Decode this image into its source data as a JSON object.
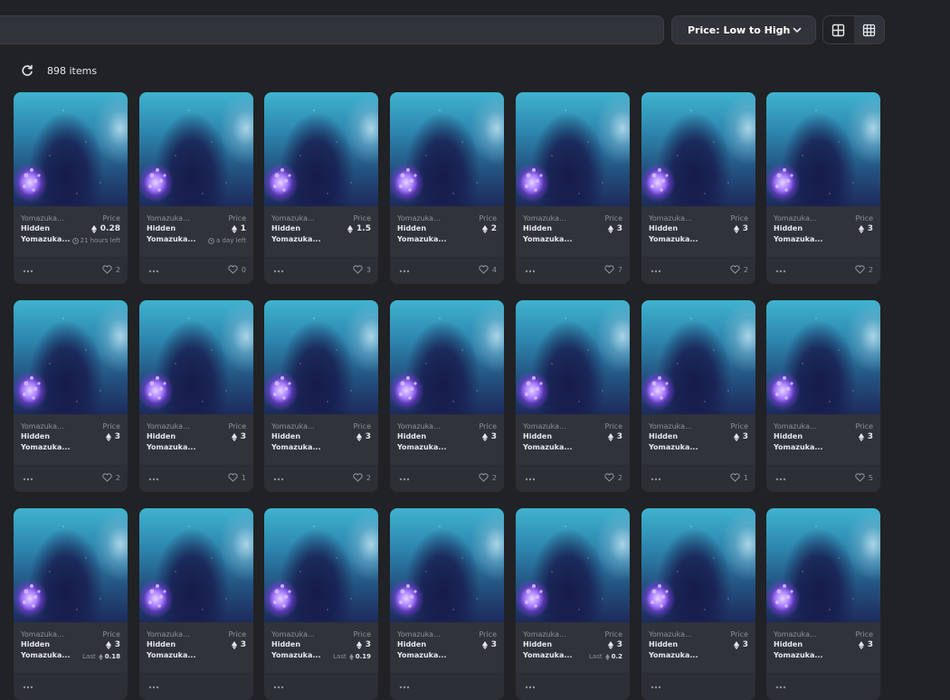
{
  "toolbar": {
    "sort_label": "Price: Low to High",
    "view_options": [
      "large-grid",
      "small-grid"
    ],
    "active_view": "small-grid"
  },
  "results": {
    "count_text": "898 items"
  },
  "card_defaults": {
    "collection": "Yomazuka...",
    "name_line1": "Hidden",
    "name_line2": "Yomazuka...",
    "price_label": "Price"
  },
  "cards": [
    {
      "price": "0.28",
      "sub": "21 hours left",
      "sub_type": "time",
      "likes": "2"
    },
    {
      "price": "1",
      "sub": "a day left",
      "sub_type": "time",
      "likes": "0"
    },
    {
      "price": "1.5",
      "sub": "",
      "sub_type": "",
      "likes": "3"
    },
    {
      "price": "2",
      "sub": "",
      "sub_type": "",
      "likes": "4"
    },
    {
      "price": "3",
      "sub": "",
      "sub_type": "",
      "likes": "7"
    },
    {
      "price": "3",
      "sub": "",
      "sub_type": "",
      "likes": "2"
    },
    {
      "price": "3",
      "sub": "",
      "sub_type": "",
      "likes": "2"
    },
    {
      "price": "3",
      "sub": "",
      "sub_type": "",
      "likes": "2"
    },
    {
      "price": "3",
      "sub": "",
      "sub_type": "",
      "likes": "1"
    },
    {
      "price": "3",
      "sub": "",
      "sub_type": "",
      "likes": "2"
    },
    {
      "price": "3",
      "sub": "",
      "sub_type": "",
      "likes": "2"
    },
    {
      "price": "3",
      "sub": "",
      "sub_type": "",
      "likes": "2"
    },
    {
      "price": "3",
      "sub": "",
      "sub_type": "",
      "likes": "1"
    },
    {
      "price": "3",
      "sub": "",
      "sub_type": "",
      "likes": "5"
    },
    {
      "price": "3",
      "sub": "0.18",
      "sub_type": "last",
      "likes": ""
    },
    {
      "price": "3",
      "sub": "",
      "sub_type": "",
      "likes": ""
    },
    {
      "price": "3",
      "sub": "0.19",
      "sub_type": "last",
      "likes": ""
    },
    {
      "price": "3",
      "sub": "",
      "sub_type": "",
      "likes": ""
    },
    {
      "price": "3",
      "sub": "0.2",
      "sub_type": "last",
      "likes": ""
    },
    {
      "price": "3",
      "sub": "",
      "sub_type": "",
      "likes": ""
    },
    {
      "price": "3",
      "sub": "",
      "sub_type": "",
      "likes": ""
    }
  ],
  "last_label": "Last",
  "icons": {
    "refresh": "refresh-icon",
    "chevron": "chevron-down-icon",
    "eth": "ethereum-icon",
    "heart": "heart-icon",
    "more": "more-options-icon",
    "clock": "clock-icon"
  },
  "colors": {
    "background": "#202225",
    "card": "#303339",
    "text": "#e5e8eb",
    "muted": "#8a939b"
  }
}
